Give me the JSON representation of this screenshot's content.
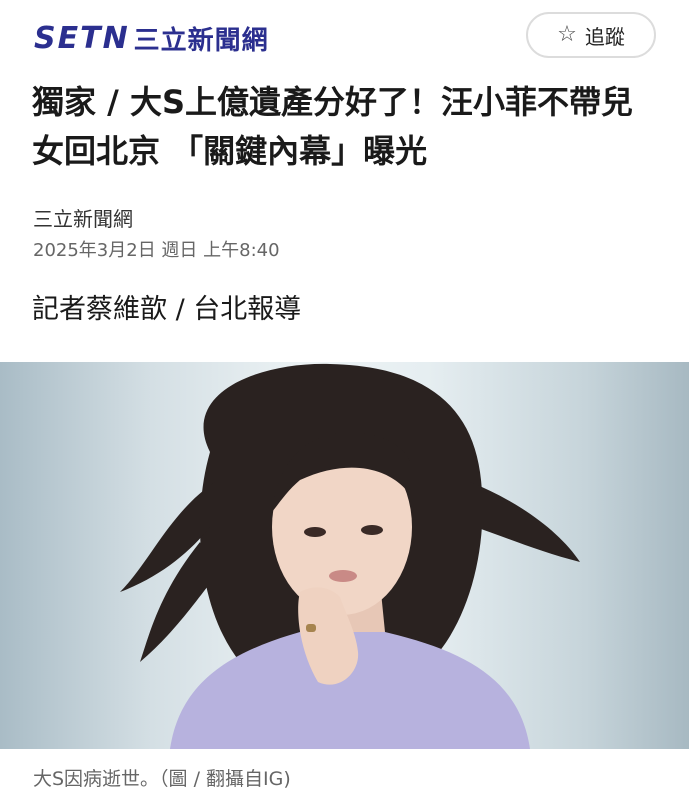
{
  "header": {
    "logo_text": "SETN",
    "logo_cn": "三立新聞網",
    "follow_label": "追蹤",
    "follow_icon": "star-outline-icon"
  },
  "article": {
    "title": "獨家 / 大S上億遺產分好了！汪小菲不帶兒女回北京 「關鍵內幕」曝光",
    "source": "三立新聞網",
    "date": "2025年3月2日 週日 上午8:40",
    "reporter": "記者蔡維歆 / 台北報導",
    "caption": "大S因病逝世。（圖 / 翻攝自IG)"
  },
  "colors": {
    "brand": "#2b2f8f",
    "title": "#1a1a1a",
    "meta": "#666666"
  }
}
